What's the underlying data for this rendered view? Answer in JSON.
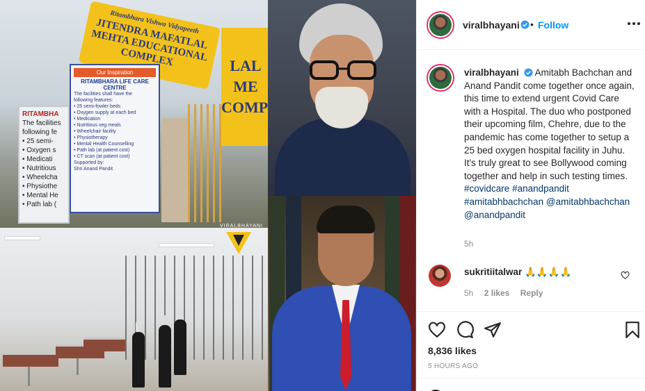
{
  "post": {
    "username": "viralbhayani",
    "verified": true,
    "separator": "•",
    "follow_label": "Follow",
    "more_options_icon": "more-horizontal-icon"
  },
  "caption": {
    "username": "viralbhayani",
    "text_before_tags": "Amitabh Bachchan and Anand Pandit come together once again, this time to extend urgent Covid Care with a Hospital. The duo who postponed their upcoming film, Chehre, due to the pandemic has come together to setup a 25 bed oxygen hospital facility in Juhu. It's truly great to see Bollywood coming together and help in such testing times.",
    "tags": [
      "#covidcare",
      "#anandpandit",
      "#amitabhbachchan",
      "@amitabhbachchan",
      "@anandpandit"
    ],
    "time": "5h"
  },
  "comment": {
    "username": "sukritiitalwar",
    "text": "🙏🙏🙏🙏",
    "time": "5h",
    "likes": "2 likes",
    "reply_label": "Reply"
  },
  "actions": {
    "likes": "8,836 likes",
    "posted": "5 HOURS AGO"
  },
  "image": {
    "sign_main_small": "Ritambhara Vishwa Vidyapeeth",
    "sign_main_big": "JITENDRA MAFATLAL MEHTA EDUCATIONAL COMPLEX",
    "sign_side_big": "LAL ME COMPLE",
    "banner_head": "Our Inspiration",
    "banner_title": "RITAMBHARA LIFE CARE CENTRE",
    "banner_lines": [
      "The facilities shall have the",
      "following features:",
      "• 25 semi-fowler beds",
      "• Oxygen supply at each bed",
      "• Medication",
      "• Nutritious veg meals",
      "• Wheelchair facility",
      "• Physiotherapy",
      "• Mental Health Counselling",
      "• Path lab (at patient cost)",
      "• CT scan (at patient cost)",
      "Supported by:",
      "Shri Anand Pandit"
    ],
    "side_board_head": "RITAMBHA",
    "side_board_lines": [
      "The facilities",
      "following fe",
      "• 25 semi-",
      "• Oxygen s",
      "• Medicati",
      "• Nutritious",
      "• Wheelcha",
      "• Physiothe",
      "• Mental He",
      "• Path lab ("
    ],
    "watermark": "VIRALBHAYANI"
  },
  "colors": {
    "link": "#00376b",
    "follow": "#0095f6",
    "muted": "#8e8e8e",
    "story_ring": "#e1306c"
  }
}
